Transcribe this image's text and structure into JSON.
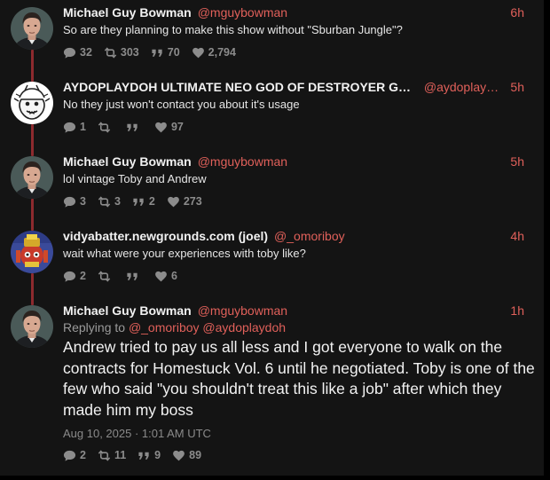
{
  "tweets": [
    {
      "name": "Michael Guy Bowman",
      "handle": "@mguybowman",
      "time": "6h",
      "text": "So are they planning to make this show without \"Sburban Jungle\"?",
      "avatar": "michael-avatar",
      "stats": {
        "replies": "32",
        "retweets": "303",
        "quotes": "70",
        "likes": "2,794"
      }
    },
    {
      "name": "AYDOPLAYDOH ULTIMATE NEO GOD OF DESTROYER GO...",
      "handle": "@aydoplayd...",
      "time": "5h",
      "text": "No they just won't contact you about it's usage",
      "avatar": "aydo-avatar",
      "stats": {
        "replies": "1",
        "retweets": "",
        "quotes": "",
        "likes": "97"
      }
    },
    {
      "name": "Michael Guy Bowman",
      "handle": "@mguybowman",
      "time": "5h",
      "text": "lol vintage Toby and Andrew",
      "avatar": "michael-avatar",
      "stats": {
        "replies": "3",
        "retweets": "3",
        "quotes": "2",
        "likes": "273"
      }
    },
    {
      "name": "vidyabatter.newgrounds.com (joel)",
      "handle": "@_omoriboy",
      "time": "4h",
      "text": "wait what were your experiences with toby like?",
      "avatar": "joel-avatar",
      "stats": {
        "replies": "2",
        "retweets": "",
        "quotes": "",
        "likes": "6"
      }
    },
    {
      "name": "Michael Guy Bowman",
      "handle": "@mguybowman",
      "time": "1h",
      "replying_label": "Replying to",
      "replying_to": "@_omoriboy @aydoplaydoh",
      "text": "Andrew tried to pay us all less and I got everyone to walk on the contracts for Homestuck Vol. 6 until he negotiated. Toby is one of the few who said \"you shouldn't treat this like a job\" after which they made him my boss",
      "date": "Aug 10, 2025 · 1:01 AM UTC",
      "avatar": "michael-avatar",
      "stats": {
        "replies": "2",
        "retweets": "11",
        "quotes": "9",
        "likes": "89"
      }
    }
  ],
  "colors": {
    "background": "#141414",
    "accent": "#e0605a",
    "thread_line": "#8d2a2e",
    "stat_text": "#8c8c8c"
  },
  "icons": {
    "replies": "comment-icon",
    "retweets": "retweet-icon",
    "quotes": "quote-icon",
    "likes": "heart-icon"
  }
}
